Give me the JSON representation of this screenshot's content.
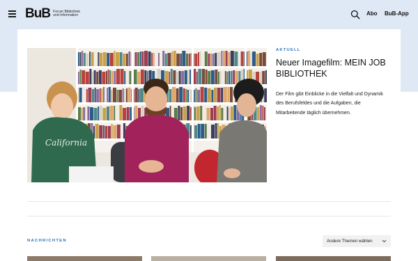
{
  "header": {
    "logo_text": "BuB",
    "logo_subtitle": "Forum Bibliothek und Information",
    "nav": [
      {
        "label": "Abo"
      },
      {
        "label": "BuB-App"
      }
    ],
    "icons": [
      "menu-icon",
      "search-icon"
    ]
  },
  "featured": {
    "kicker": "AKTUELL",
    "title": "Neuer Imagefilm: MEIN JOB BIBLIOTHEK",
    "teaser": "Der Film gibt Einblicke in die Vielfalt und Dynamik des Berufsfeldes und die Aufgaben, die Mitarbeitende täglich übernehmen.",
    "image_alt": "Drei Personen sitzen vor Bücherregalen in einer Bibliothek"
  },
  "news": {
    "section_label": "NACHRICHTEN",
    "topic_select": "Andere Themen wählen"
  },
  "colors": {
    "band": "#dfe9f6",
    "accent": "#2a6fb8"
  }
}
